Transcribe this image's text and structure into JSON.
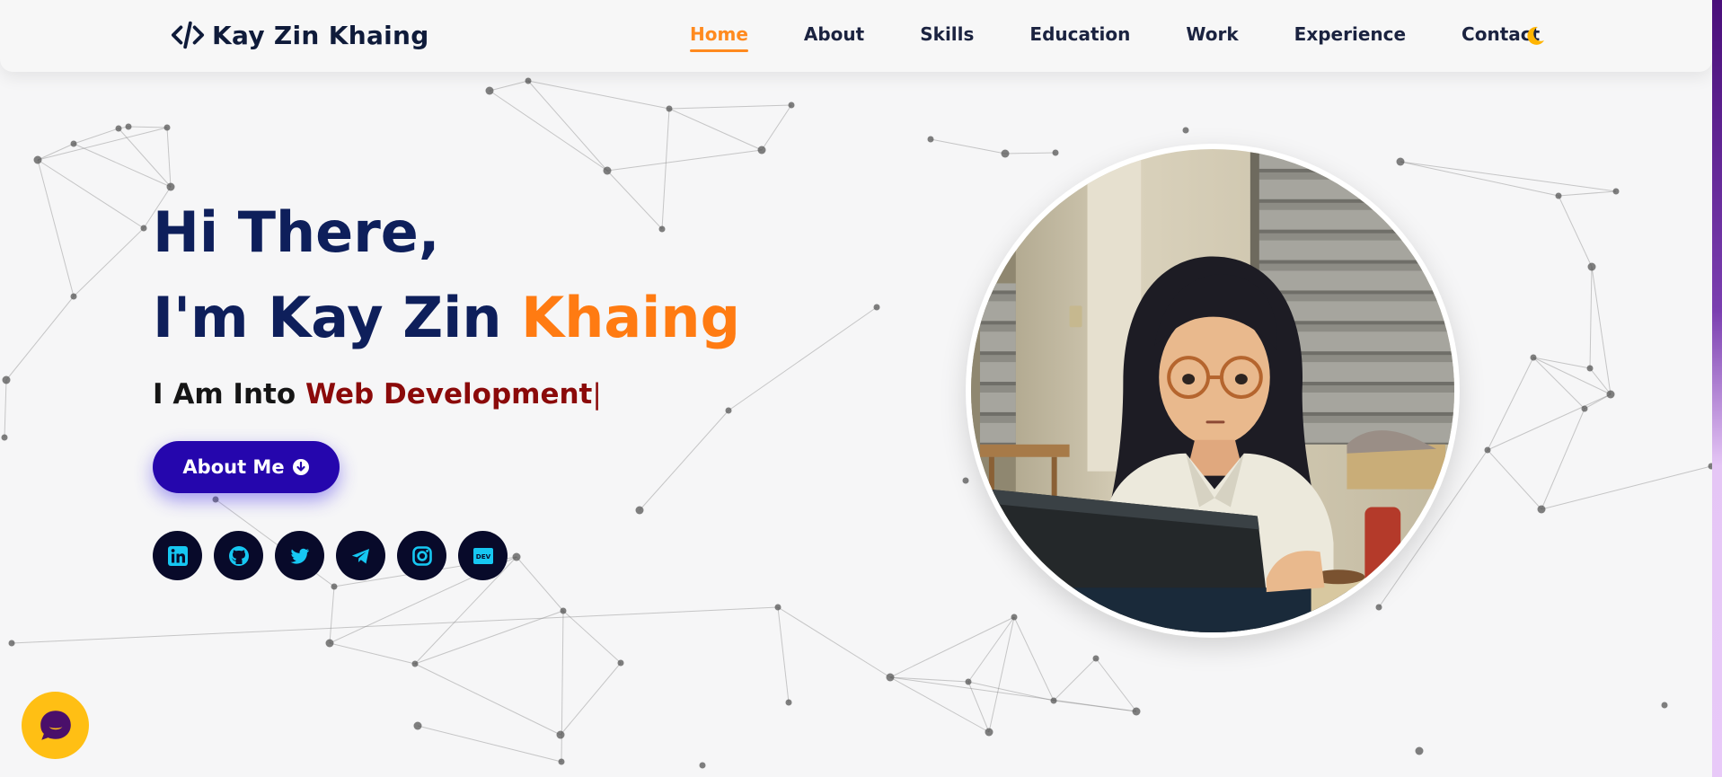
{
  "header": {
    "logo_text": "Kay Zin Khaing",
    "logo_icon": "code-icon",
    "nav": [
      {
        "label": "Home",
        "active": true
      },
      {
        "label": "About",
        "active": false
      },
      {
        "label": "Skills",
        "active": false
      },
      {
        "label": "Education",
        "active": false
      },
      {
        "label": "Work",
        "active": false
      },
      {
        "label": "Experience",
        "active": false
      },
      {
        "label": "Contact",
        "active": false
      }
    ],
    "theme_icon": "moon-icon"
  },
  "hero": {
    "greeting": "Hi There,",
    "name_prefix": "I'm Kay Zin ",
    "name_accent": "Khaing",
    "typed_prefix": "I Am Into ",
    "typed_text": "Web Development",
    "typed_cursor": "|",
    "cta_label": "About Me",
    "cta_icon": "arrow-circle-down-icon",
    "socials": [
      "linkedin-icon",
      "github-icon",
      "twitter-icon",
      "telegram-icon",
      "instagram-icon",
      "dev-icon"
    ],
    "dev_icon_text": "DEV"
  },
  "chat": {
    "icon": "chat-icon"
  },
  "colors": {
    "accent": "#ff8a1f",
    "navy": "#0e1f5b",
    "button": "#2506ad",
    "typed": "#8b0a0a",
    "social_bg": "#080a2a",
    "social_icon": "#16c7f2",
    "chat": "#ffbf14",
    "chat_icon": "#4a0f6a"
  }
}
